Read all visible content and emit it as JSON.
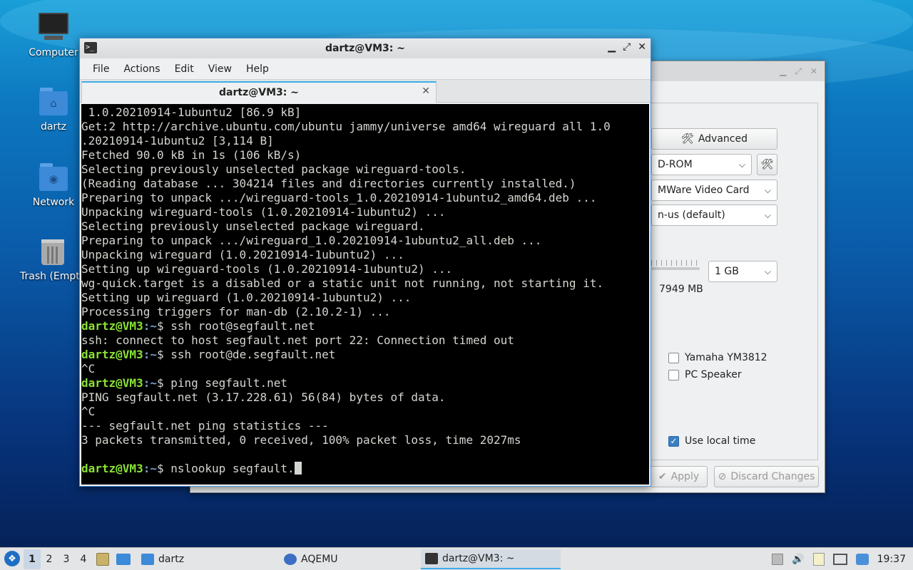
{
  "desktop": {
    "icons": [
      {
        "label": "Computer"
      },
      {
        "label": "dartz"
      },
      {
        "label": "Network"
      },
      {
        "label": "Trash (Empty)"
      }
    ]
  },
  "aqemu": {
    "advanced_button": "Advanced",
    "cdrom_combo": "D-ROM",
    "video_combo": "MWare Video Card",
    "keyboard_combo": "n-us (default)",
    "memory_combo": "1 GB",
    "memory_free": "7949 MB",
    "sound_yamaha": "Yamaha YM3812",
    "sound_speaker": "PC Speaker",
    "use_local_time": "Use local time",
    "apply_button": "Apply",
    "discard_button": "Discard Changes"
  },
  "terminal": {
    "title": "dartz@VM3: ~",
    "tab_title": "dartz@VM3: ~",
    "menu": [
      "File",
      "Actions",
      "Edit",
      "View",
      "Help"
    ],
    "prompt_user": "dartz@VM3",
    "prompt_path": ":~",
    "lines": [
      " 1.0.20210914-1ubuntu2 [86.9 kB]",
      "Get:2 http://archive.ubuntu.com/ubuntu jammy/universe amd64 wireguard all 1.0",
      ".20210914-1ubuntu2 [3,114 B]",
      "Fetched 90.0 kB in 1s (106 kB/s)",
      "Selecting previously unselected package wireguard-tools.",
      "(Reading database ... 304214 files and directories currently installed.)",
      "Preparing to unpack .../wireguard-tools_1.0.20210914-1ubuntu2_amd64.deb ...",
      "Unpacking wireguard-tools (1.0.20210914-1ubuntu2) ...",
      "Selecting previously unselected package wireguard.",
      "Preparing to unpack .../wireguard_1.0.20210914-1ubuntu2_all.deb ...",
      "Unpacking wireguard (1.0.20210914-1ubuntu2) ...",
      "Setting up wireguard-tools (1.0.20210914-1ubuntu2) ...",
      "wg-quick.target is a disabled or a static unit not running, not starting it.",
      "Setting up wireguard (1.0.20210914-1ubuntu2) ...",
      "Processing triggers for man-db (2.10.2-1) ..."
    ],
    "cmd1": "$ ssh root@segfault.net",
    "out1": "ssh: connect to host segfault.net port 22: Connection timed out",
    "cmd2": "$ ssh root@de.segfault.net",
    "out2": "^C",
    "cmd3": "$ ping segfault.net",
    "out3": [
      "PING segfault.net (3.17.228.61) 56(84) bytes of data.",
      "^C",
      "--- segfault.net ping statistics ---",
      "3 packets transmitted, 0 received, 100% packet loss, time 2027ms"
    ],
    "cmd4": "$ nslookup segfault."
  },
  "taskbar": {
    "workspaces": [
      "1",
      "2",
      "3",
      "4"
    ],
    "folder_task": "dartz",
    "aqemu_task": "AQEMU",
    "terminal_task": "dartz@VM3: ~",
    "clock": "19:37"
  }
}
